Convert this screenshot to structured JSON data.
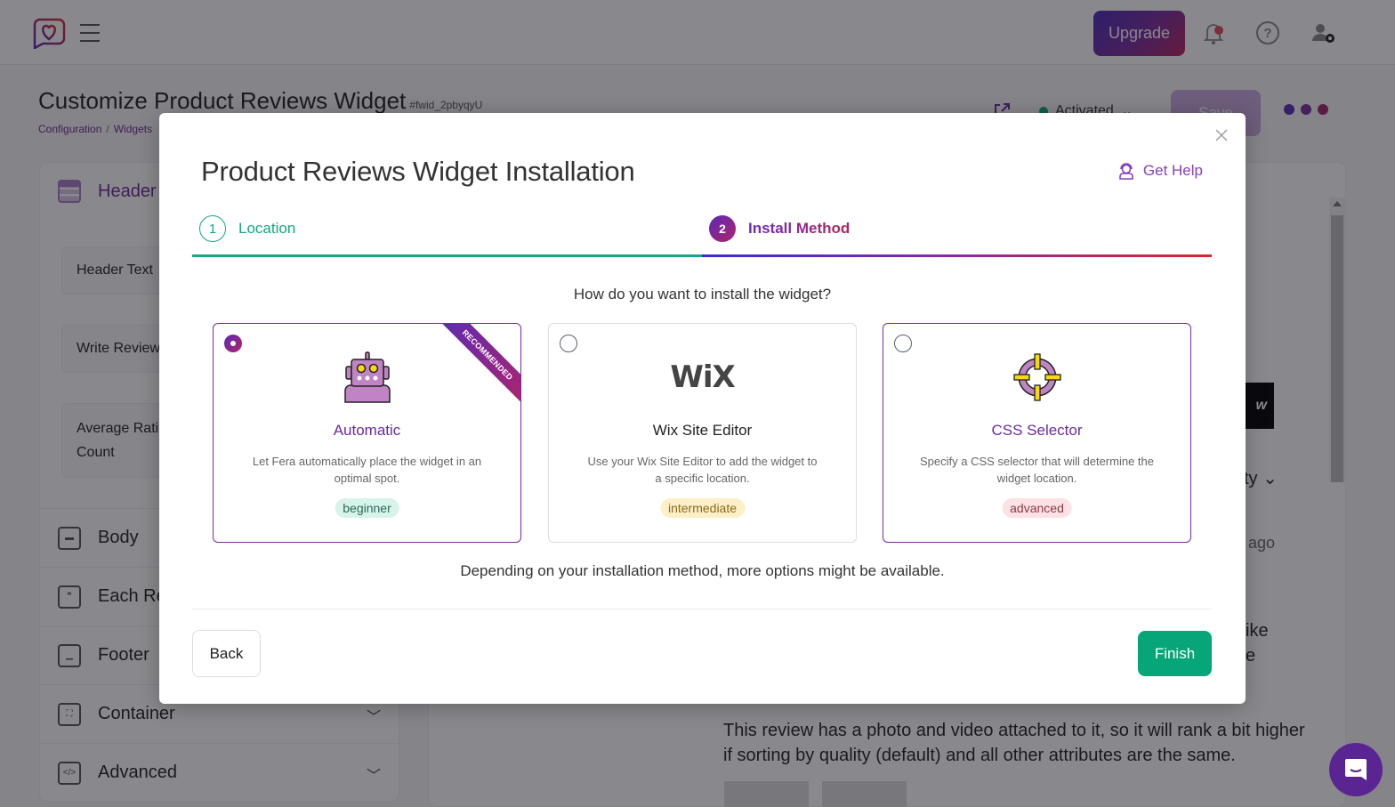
{
  "topbar": {
    "upgrade_label": "Upgrade",
    "icons": [
      "logo-icon",
      "menu-icon",
      "bell-icon",
      "help-icon",
      "user-settings-icon"
    ]
  },
  "page": {
    "title": "Customize Product Reviews Widget",
    "widget_id": "#fwid_2pbyqyU",
    "breadcrumb": [
      "Configuration",
      "Widgets"
    ],
    "status_label": "Activated",
    "save_label": "Save"
  },
  "left_panel": {
    "header_label": "Header",
    "fields": [
      "Header Text",
      "Write Review",
      "Average Rating Count"
    ],
    "field_avg_line1": "Average Rati",
    "field_avg_line2": "Count",
    "sections": [
      {
        "label": "Body"
      },
      {
        "label": "Each Review"
      },
      {
        "label": "Footer"
      },
      {
        "label": "Container"
      },
      {
        "label": "Advanced"
      }
    ]
  },
  "preview": {
    "sort_fragment": "ty",
    "time_fragment": "r ago",
    "like_fragment": "ike",
    "e_fragment": "e",
    "write_button_fragment": "w",
    "review_text_line1": "This review has a photo and video attached to it, so it will rank a bit higher",
    "review_text_line2": "if sorting by quality (default) and all other attributes are the same."
  },
  "modal": {
    "title": "Product Reviews Widget Installation",
    "get_help_label": "Get Help",
    "steps": [
      {
        "number": "1",
        "label": "Location",
        "state": "complete"
      },
      {
        "number": "2",
        "label": "Install Method",
        "state": "active"
      }
    ],
    "question": "How do you want to install the widget?",
    "options": [
      {
        "title": "Automatic",
        "description": "Let Fera automatically place the widget in an optimal spot.",
        "level": "beginner",
        "ribbon": "RECOMMENDED",
        "selected": true,
        "icon": "robot-icon"
      },
      {
        "title": "Wix Site Editor",
        "description": "Use your Wix Site Editor to add the widget to a specific location.",
        "level": "intermediate",
        "selected": false,
        "icon": "wix-logo-icon",
        "logo_text": "WiX"
      },
      {
        "title": "CSS Selector",
        "description": "Specify a CSS selector that will determine the widget location.",
        "level": "advanced",
        "selected": false,
        "icon": "crosshair-icon"
      }
    ],
    "footnote": "Depending on your installation method, more options might be available.",
    "back_label": "Back",
    "finish_label": "Finish"
  },
  "colors": {
    "brand_purple": "#6b2a9e",
    "success_green": "#07a678",
    "step_complete": "#12a884"
  }
}
